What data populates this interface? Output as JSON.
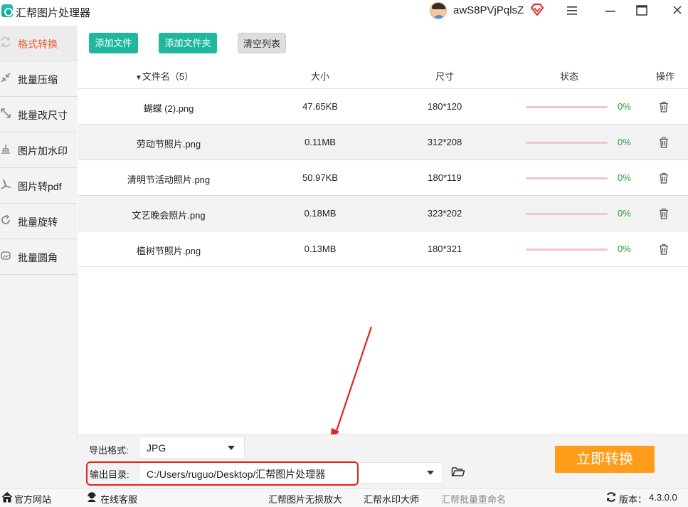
{
  "window": {
    "title": "汇帮图片处理器",
    "username": "awS8PVjPqlsZ"
  },
  "sidebar": {
    "items": [
      {
        "label": "格式转换",
        "icon": "format-convert-icon",
        "active": true
      },
      {
        "label": "批量压缩",
        "icon": "compress-icon",
        "active": false
      },
      {
        "label": "批量改尺寸",
        "icon": "resize-icon",
        "active": false
      },
      {
        "label": "图片加水印",
        "icon": "watermark-icon",
        "active": false
      },
      {
        "label": "图片转pdf",
        "icon": "pdf-icon",
        "active": false
      },
      {
        "label": "批量旋转",
        "icon": "rotate-icon",
        "active": false
      },
      {
        "label": "批量圆角",
        "icon": "round-corner-icon",
        "active": false
      }
    ]
  },
  "toolbar": {
    "add_file": "添加文件",
    "add_folder": "添加文件夹",
    "clear_list": "清空列表"
  },
  "table": {
    "headers": {
      "name": "文件名（5）",
      "size": "大小",
      "dimension": "尺寸",
      "status": "状态",
      "action": "操作"
    },
    "rows": [
      {
        "name": "蝴蝶 (2).png",
        "size": "47.65KB",
        "dimension": "180*120",
        "progress": 0,
        "percent": "0%"
      },
      {
        "name": "劳动节照片.png",
        "size": "0.11MB",
        "dimension": "312*208",
        "progress": 0,
        "percent": "0%"
      },
      {
        "name": "清明节活动照片.png",
        "size": "50.97KB",
        "dimension": "180*119",
        "progress": 0,
        "percent": "0%"
      },
      {
        "name": "文艺晚会照片.png",
        "size": "0.18MB",
        "dimension": "323*202",
        "progress": 0,
        "percent": "0%"
      },
      {
        "name": "植树节照片.png",
        "size": "0.13MB",
        "dimension": "180*321",
        "progress": 0,
        "percent": "0%"
      }
    ]
  },
  "output": {
    "format_label": "导出格式:",
    "format_value": "JPG",
    "dir_label": "输出目录:",
    "dir_value": "C:/Users/ruguo/Desktop/汇帮图片处理器",
    "convert_button": "立即转换"
  },
  "statusbar": {
    "website": "官方网站",
    "support": "在线客服",
    "link1": "汇帮图片无损放大",
    "link2": "汇帮水印大师",
    "link3": "汇帮批量重命名",
    "version_label": "版本：",
    "version": "4.3.0.0"
  },
  "colors": {
    "accent": "#1fb89f",
    "active_text": "#f05a2a",
    "convert": "#ff9d1a",
    "annotation": "#e2231a",
    "progress_track": "#f2c4d0",
    "percent_text": "#2a9a36"
  }
}
